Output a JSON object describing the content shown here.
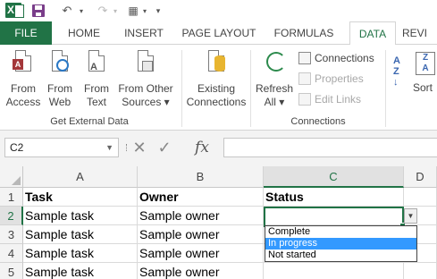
{
  "ribbon_tabs": [
    "FILE",
    "HOME",
    "INSERT",
    "PAGE LAYOUT",
    "FORMULAS",
    "DATA",
    "REVI"
  ],
  "active_tab": "DATA",
  "colors": {
    "excel_green": "#217346",
    "highlight_blue": "#3399ff"
  },
  "get_external_data": {
    "label": "Get External Data",
    "buttons": [
      {
        "line1": "From",
        "line2": "Access",
        "icon": "access-icon"
      },
      {
        "line1": "From",
        "line2": "Web",
        "icon": "web-icon"
      },
      {
        "line1": "From",
        "line2": "Text",
        "icon": "text-icon"
      },
      {
        "line1": "From Other",
        "line2": "Sources ▾",
        "icon": "other-sources-icon"
      }
    ]
  },
  "existing_connections": {
    "line1": "Existing",
    "line2": "Connections",
    "icon": "existing-connections-icon"
  },
  "connections": {
    "label": "Connections",
    "refresh": {
      "line1": "Refresh",
      "line2": "All ▾",
      "icon": "refresh-icon"
    },
    "items": [
      "Connections",
      "Properties",
      "Edit Links"
    ]
  },
  "sort": {
    "label": "Sort",
    "az": "A\nZ"
  },
  "formula_bar": {
    "name_box": "C2",
    "cancel": "✕",
    "enter": "✓",
    "fx": "fx",
    "formula": ""
  },
  "columns": [
    "A",
    "B",
    "C",
    "D"
  ],
  "selected_column": "C",
  "rows": [
    {
      "num": "1",
      "cells": [
        "Task",
        "Owner",
        "Status"
      ]
    },
    {
      "num": "2",
      "cells": [
        "Sample task",
        "Sample owner",
        ""
      ]
    },
    {
      "num": "3",
      "cells": [
        "Sample task",
        "Sample owner",
        ""
      ]
    },
    {
      "num": "4",
      "cells": [
        "Sample task",
        "Sample owner",
        ""
      ]
    },
    {
      "num": "5",
      "cells": [
        "Sample task",
        "Sample owner",
        ""
      ]
    }
  ],
  "selected_row": "2",
  "dropdown": {
    "options": [
      "Complete",
      "In progress",
      "Not started"
    ],
    "highlighted": "In progress"
  }
}
